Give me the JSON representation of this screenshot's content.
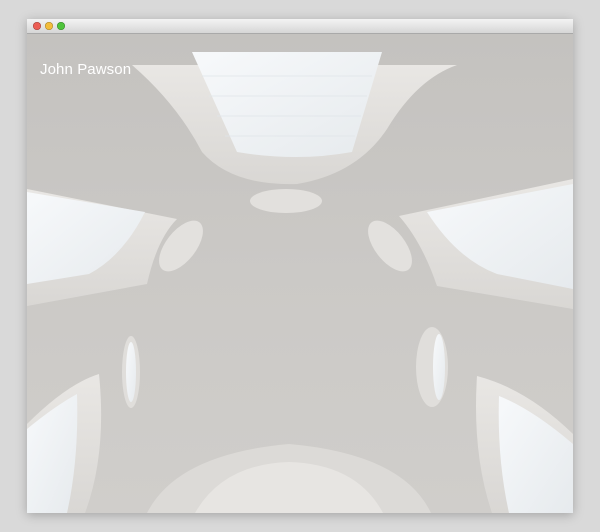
{
  "site": {
    "title": "John Pawson"
  },
  "hero": {
    "image": "architectural-ceiling-photo",
    "colors": {
      "wall": "#c9c7c4",
      "light_surface": "#e8e6e3",
      "skylight": "#f4f7f9"
    }
  }
}
